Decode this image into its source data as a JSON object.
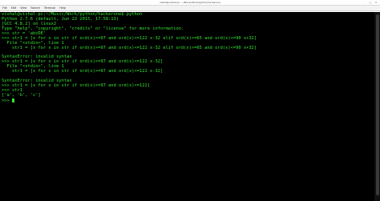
{
  "window": {
    "title": "vishal@vishal-pc: ~/Music/Work/python/hackerone"
  },
  "menu": {
    "items": [
      "File",
      "Edit",
      "View",
      "Search",
      "Terminal",
      "Help"
    ]
  },
  "terminal": {
    "lines": [
      "vishal@vishal-pc:~/Music/Work/python/hackerone$ python",
      "Python 2.7.6 (default, Jun 22 2015, 17:58:13)",
      "[GCC 4.8.2] on linux2",
      "Type \"help\", \"copyright\", \"credits\" or \"license\" for more information.",
      ">>> str = 'abcDE'",
      ">>> str1 = [x for x in str if ord(x)>=97 and ord(x)<=122 x-32 elif ord(x)>=65 and ord(x)<=90 x+32]",
      "  File \"<stdin>\", line 1",
      "    str1 = [x for x in str if ord(x)>=97 and ord(x)<=122 x-32 elif ord(x)>=65 and ord(x)<=90 x+32]",
      "",
      "SyntaxError: invalid syntax",
      ">>> str1 = [x for x in str if ord(x)>=97 and ord(x)<=122 x-32]",
      "  File \"<stdin>\", line 1",
      "    str1 = [x for x in str if ord(x)>=97 and ord(x)<=122 x-32]",
      "",
      "SyntaxError: invalid syntax",
      ">>> str1 = [x for x in str if ord(x)>=97 and ord(x)<=122]",
      ">>> str1",
      "['a', 'b', 'c']",
      ">>> "
    ]
  },
  "colors": {
    "terminal_bg": "#000000",
    "terminal_fg": "#33e533"
  }
}
